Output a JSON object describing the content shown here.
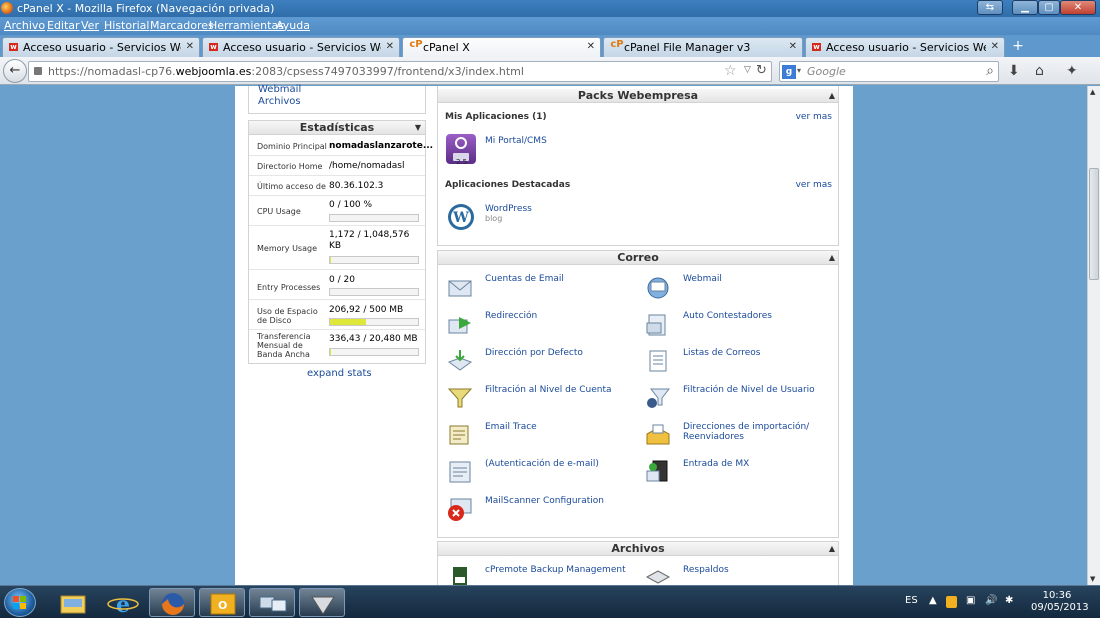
{
  "window": {
    "title": "cPanel X - Mozilla Firefox (Navegación privada)"
  },
  "menu": [
    "Archivo",
    "Editar",
    "Ver",
    "Historial",
    "Marcadores",
    "Herramientas",
    "Ayuda"
  ],
  "tabs": [
    {
      "title": "Acceso usuario - Servicios Web Joom...",
      "icon": "joomla-favicon",
      "active": false
    },
    {
      "title": "Acceso usuario - Servicios Web Joom...",
      "icon": "joomla-favicon",
      "active": false
    },
    {
      "title": "cPanel X",
      "icon": "cpanel-favicon",
      "active": true
    },
    {
      "title": "cPanel File Manager v3",
      "icon": "cpanel-favicon",
      "active": false
    },
    {
      "title": "Acceso usuario - Servicios Web Joom...",
      "icon": "joomla-favicon",
      "active": false
    }
  ],
  "nav": {
    "url_prefix": "https://nomadasl-cp76.",
    "url_domain": "webjoomla.es",
    "url_suffix": ":2083/cpsess7497033997/frontend/x3/index.html",
    "search_placeholder": "Google"
  },
  "sidebar": {
    "links": [
      "Webmail",
      "Archivos"
    ],
    "stats_title": "Estadísticas",
    "stats": [
      {
        "label": "Dominio Principal",
        "value": "nomadaslanzarote...",
        "bold": true
      },
      {
        "label": "Directorio Home",
        "value": "/home/nomadasl"
      },
      {
        "label": "Último acceso de",
        "value": "80.36.102.3"
      },
      {
        "label": "CPU Usage",
        "value": "0 / 100 %",
        "percent": 0
      },
      {
        "label": "Memory Usage",
        "value": "1,172 / 1,048,576 KB",
        "percent": 0.1
      },
      {
        "label": "Entry Processes",
        "value": "0 / 20",
        "percent": 0
      },
      {
        "label": "Uso de Espacio de Disco",
        "value": "206,92 / 500 MB",
        "percent": 41.4
      },
      {
        "label": "Transferencia Mensual de Banda Ancha",
        "value": "336,43 / 20,480 MB",
        "percent": 1.6
      }
    ],
    "expand_label": "expand stats"
  },
  "packs": {
    "title": "Packs Webempresa",
    "my_apps_label": "Mis Aplicaciones (1)",
    "ver_mas": "ver mas",
    "my_apps": [
      {
        "label": "Mi Portal/CMS",
        "icon": "joomla-icon",
        "badge": "2.5"
      }
    ],
    "featured_label": "Aplicaciones Destacadas",
    "featured": [
      {
        "label": "WordPress",
        "sub": "blog",
        "icon": "wordpress-icon"
      }
    ]
  },
  "correo": {
    "title": "Correo",
    "items": [
      {
        "label": "Cuentas de Email",
        "icon": "email-accounts-icon"
      },
      {
        "label": "Webmail",
        "icon": "webmail-icon"
      },
      {
        "label": "Redirección",
        "icon": "forwarders-icon"
      },
      {
        "label": "Auto Contestadores",
        "icon": "autoresponders-icon"
      },
      {
        "label": "Dirección por Defecto",
        "icon": "default-address-icon"
      },
      {
        "label": "Listas de Correos",
        "icon": "mailing-lists-icon"
      },
      {
        "label": "Filtración al Nivel de Cuenta",
        "icon": "account-filter-icon"
      },
      {
        "label": "Filtración de Nivel de Usuario",
        "icon": "user-filter-icon"
      },
      {
        "label": "Email Trace",
        "icon": "email-trace-icon"
      },
      {
        "label": "Direcciones de importación/ Reenviadores",
        "icon": "import-addresses-icon"
      },
      {
        "label": "(Autenticación de e-mail)",
        "icon": "email-auth-icon"
      },
      {
        "label": "Entrada de MX",
        "icon": "mx-entry-icon"
      },
      {
        "label": "MailScanner Configuration",
        "icon": "mailscanner-icon"
      }
    ]
  },
  "archivos": {
    "title": "Archivos",
    "items": [
      {
        "label": "cPremote Backup Management",
        "icon": "backup-management-icon"
      },
      {
        "label": "Respaldos",
        "icon": "backups-icon"
      }
    ]
  },
  "taskbar": {
    "lang": "ES",
    "time": "10:36",
    "date": "09/05/2013"
  }
}
